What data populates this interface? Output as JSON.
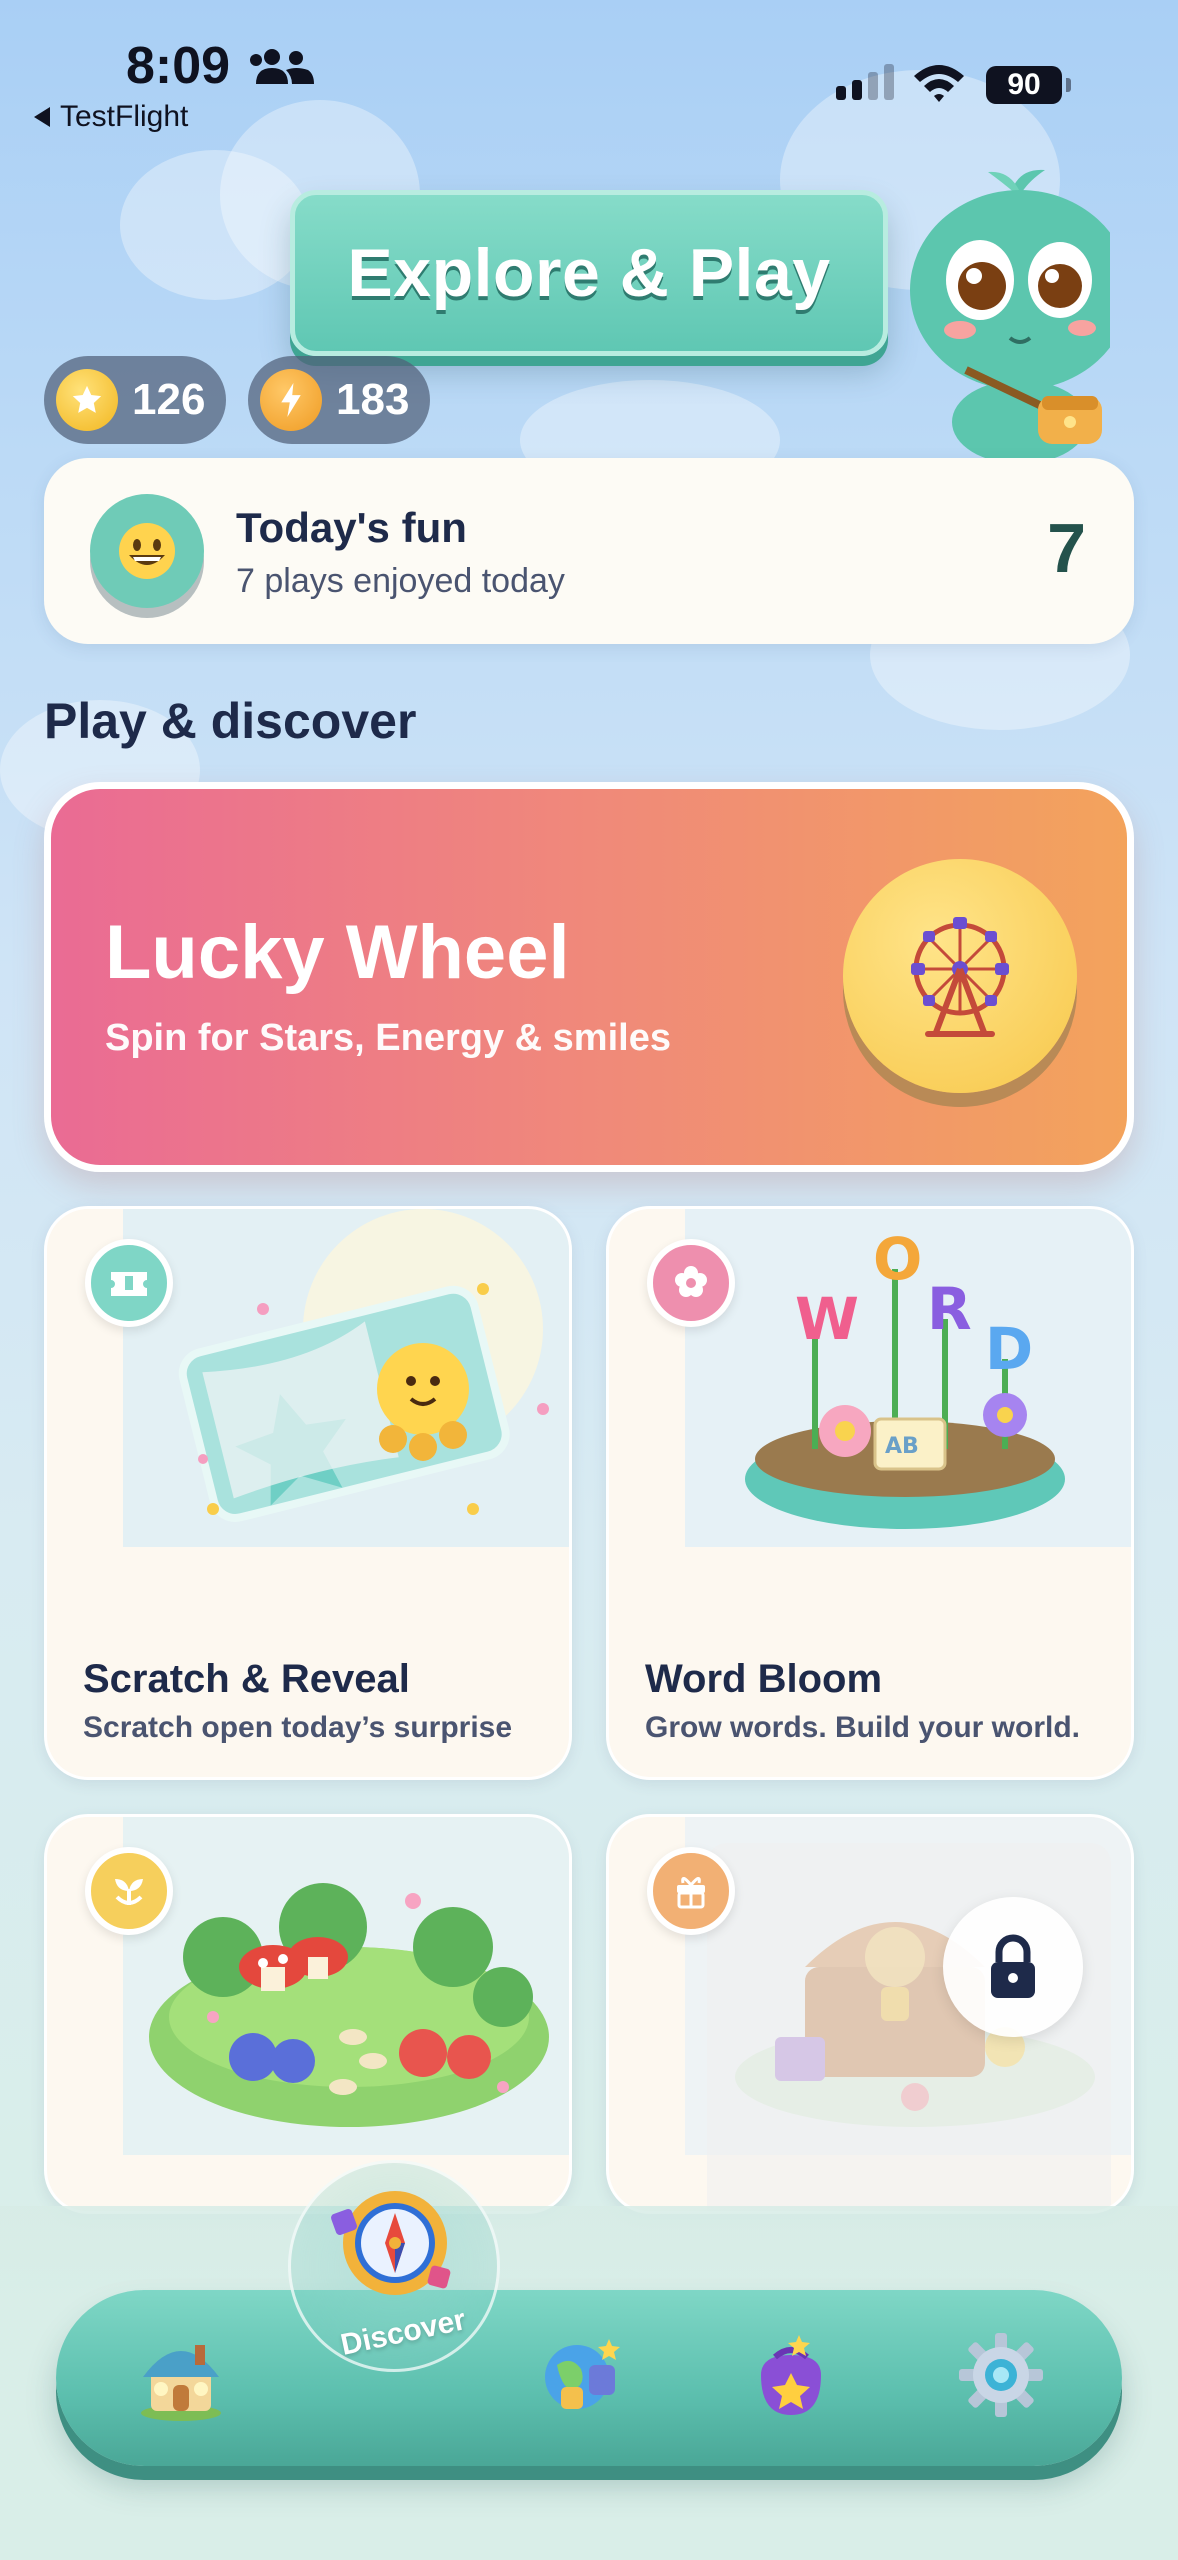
{
  "status_bar": {
    "time": "8:09",
    "back_label": "TestFlight",
    "battery": "90"
  },
  "header": {
    "title": "Explore & Play"
  },
  "currency": {
    "stars": "126",
    "energy": "183"
  },
  "today": {
    "title": "Today's fun",
    "subtitle": "7 plays enjoyed today",
    "count": "7"
  },
  "section_title": "Play & discover",
  "featured": {
    "title": "Lucky Wheel",
    "subtitle": "Spin for Stars, Energy & smiles"
  },
  "games": [
    {
      "title": "Scratch & Reveal",
      "subtitle": "Scratch open today’s surprise",
      "badge_icon": "ticket-icon",
      "badge_color": "#7fd6c6"
    },
    {
      "title": "Word Bloom",
      "subtitle": "Grow words. Build your world.",
      "badge_icon": "flower-icon",
      "badge_color": "#ee8fae"
    },
    {
      "title": "",
      "subtitle": "",
      "badge_icon": "sprout-icon",
      "badge_color": "#f6cf5c",
      "locked": false
    },
    {
      "title": "",
      "subtitle": "",
      "badge_icon": "gift-icon",
      "badge_color": "#f2b074",
      "locked": true
    }
  ],
  "tabbar": {
    "active": "Discover",
    "discover_label": "Discover",
    "tabs": [
      "home-icon",
      "compass-icon",
      "globe-icon",
      "bag-icon",
      "gear-icon"
    ]
  },
  "colors": {
    "accent_teal": "#5fc7b3",
    "lucky_gradient_start": "#ea6b94",
    "lucky_gradient_end": "#f3a35c"
  }
}
